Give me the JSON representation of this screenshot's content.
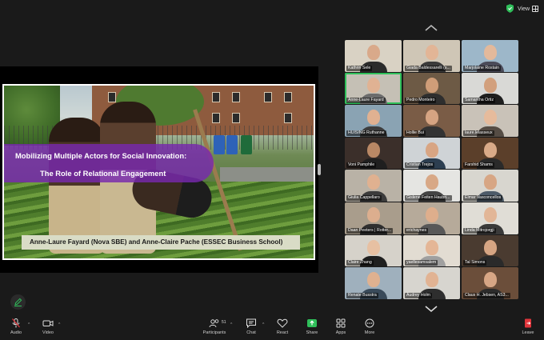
{
  "topbar": {
    "view_label": "View"
  },
  "slide": {
    "title_line1": "Mobilizing Multiple Actors for Social Innovation:",
    "title_line2": "The Role of Relational Engagement",
    "authors": "Anne-Laure Fayard (Nova SBE) and Anne-Claire Pache (ESSEC Business School)"
  },
  "gallery": {
    "participants": [
      {
        "name": "Kathrin Sele",
        "bg": "#d9d2c4",
        "skin": "#d9a98a",
        "shirt": "#2b2b2b"
      },
      {
        "name": "Giada Baldessarelli (s...",
        "bg": "#cfc6b6",
        "skin": "#e2b596",
        "shirt": "#3a3a3a"
      },
      {
        "name": "Marjolaine Rostain",
        "bg": "#9db7c9",
        "skin": "#e3b99b",
        "shirt": "#4a4a58"
      },
      {
        "name": "Anne-Laure Fayard",
        "bg": "#c5c0b5",
        "skin": "#e0b293",
        "shirt": "#6c6c6c",
        "active": true
      },
      {
        "name": "Pedro Monteiro",
        "bg": "#6d5a45",
        "skin": "#cf9d78",
        "shirt": "#2e2e2e"
      },
      {
        "name": "Samantha Ortiz",
        "bg": "#d9d9d6",
        "skin": "#d2a07d",
        "shirt": "#1e1e1e"
      },
      {
        "name": "HUISING Ruthanne",
        "bg": "#8aa3b3",
        "skin": "#e0b191",
        "shirt": "#3d3d3d"
      },
      {
        "name": "Hollie Bui",
        "bg": "#7a5c46",
        "skin": "#d6a482",
        "shirt": "#333"
      },
      {
        "name": "laure.lelasseux",
        "bg": "#c9c2b8",
        "skin": "#e6bb9c",
        "shirt": "#554c44"
      },
      {
        "name": "Voni Pamphile",
        "bg": "#3b2f2a",
        "skin": "#b98865",
        "shirt": "#1f1f1f"
      },
      {
        "name": "Cristian Trejos",
        "bg": "#cfd3d6",
        "skin": "#d8a583",
        "shirt": "#2c3e50"
      },
      {
        "name": "Farshid Shams",
        "bg": "#5b3f2a",
        "skin": "#d9aa88",
        "shirt": "#2a2a2a"
      },
      {
        "name": "Giulia Cappellaro",
        "bg": "#b9b2a6",
        "skin": "#e0b190",
        "shirt": "#3b3b3b"
      },
      {
        "name": "Gislene Feiten Haubri...",
        "bg": "#e5e5e2",
        "skin": "#d8a886",
        "shirt": "#444"
      },
      {
        "name": "Elmar Vasconcellos",
        "bg": "#d8d6cf",
        "skin": "#d7a684",
        "shirt": "#4d5b69"
      },
      {
        "name": "Daan Peeters | Rotter...",
        "bg": "#a99d8c",
        "skin": "#dcae8e",
        "shirt": "#2f2f2f"
      },
      {
        "name": "erichaynes",
        "bg": "#b6aa9a",
        "skin": "#deae8c",
        "shirt": "#585858"
      },
      {
        "name": "Linda Mitrojorgji",
        "bg": "#e0ddd6",
        "skin": "#e2b697",
        "shirt": "#3a3a3a"
      },
      {
        "name": "Claire Zhang",
        "bg": "#d6d2ca",
        "skin": "#e7c0a2",
        "shirt": "#1f1f1f"
      },
      {
        "name": "yaellesamsalem",
        "bg": "#e2dcd2",
        "skin": "#e4b696",
        "shirt": "#a0a0a0"
      },
      {
        "name": "Tal Simons",
        "bg": "#4a3b30",
        "skin": "#d6a583",
        "shirt": "#2a2a2a"
      },
      {
        "name": "Renate Buss​tra",
        "bg": "#9fb0bd",
        "skin": "#dfb190",
        "shirt": "#394a5a"
      },
      {
        "name": "Audrey Holm",
        "bg": "#d7d5cf",
        "skin": "#e1b393",
        "shirt": "#2e2e2e"
      },
      {
        "name": "Claus H. Jebsen, AS3...",
        "bg": "#6b4e3a",
        "skin": "#d7a685",
        "shirt": "#2b2b2b"
      }
    ]
  },
  "toolbar": {
    "audio_label": "Audio",
    "video_label": "Video",
    "participants_label": "Participants",
    "participants_count": "51",
    "chat_label": "Chat",
    "react_label": "React",
    "share_label": "Share",
    "apps_label": "Apps",
    "more_label": "More",
    "leave_label": "Leave"
  }
}
